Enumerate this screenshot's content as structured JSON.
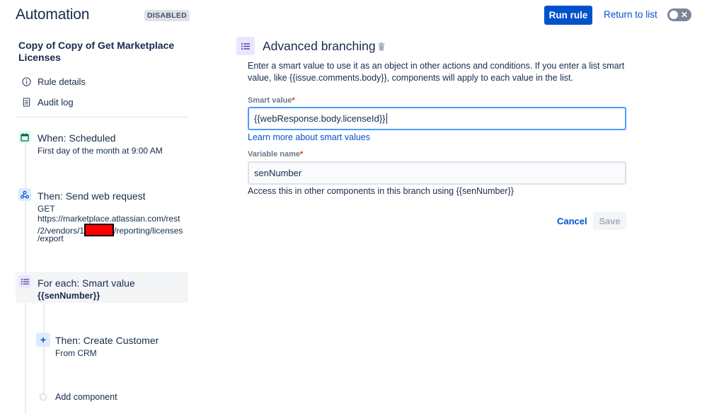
{
  "header": {
    "title": "Automation",
    "status_badge": "DISABLED",
    "run_button": "Run rule",
    "return_link": "Return to list",
    "toggle_state": "off"
  },
  "sidebar": {
    "rule_name": "Copy of Copy of Get Marketplace Licenses",
    "nav": [
      {
        "label": "Rule details",
        "icon": "info-icon"
      },
      {
        "label": "Audit log",
        "icon": "document-icon"
      }
    ],
    "steps": {
      "trigger": {
        "title": "When: Scheduled",
        "subtitle": "First day of the month at 9:00 AM",
        "icon": "calendar-icon"
      },
      "web_request": {
        "title": "Then: Send web request",
        "method": "GET",
        "url_line1": "https://marketplace.atlassian.com/rest",
        "url_line2_prefix": "/2/vendors/1",
        "url_line2_suffix": "/reporting/licenses",
        "url_line3": "/export",
        "icon": "webhook-icon"
      },
      "foreach": {
        "title": "For each: Smart value",
        "subtitle": "{{senNumber}}",
        "icon": "list-icon"
      },
      "create_customer": {
        "title": "Then: Create Customer",
        "subtitle": "From CRM",
        "icon": "plus-icon"
      },
      "add_component": "Add component"
    }
  },
  "panel": {
    "title": "Advanced branching",
    "description": "Enter a smart value to use it as an object in other actions and conditions. If you enter a list smart value, like {{issue.comments.body}}, components will apply to each value in the list.",
    "smart_value_label": "Smart value",
    "smart_value": "{{webResponse.body.licenseId}}",
    "learn_more": "Learn more about smart values",
    "variable_label": "Variable name",
    "variable_value": "senNumber",
    "helper": "Access this in other components in this branch using {{senNumber}}",
    "required_mark": "*",
    "cancel": "Cancel",
    "save": "Save"
  },
  "colors": {
    "primary": "#0052CC",
    "text": "#172B4D",
    "focus_border": "#4C9AFF",
    "required": "#DE350B",
    "redaction": "#FF0000"
  }
}
